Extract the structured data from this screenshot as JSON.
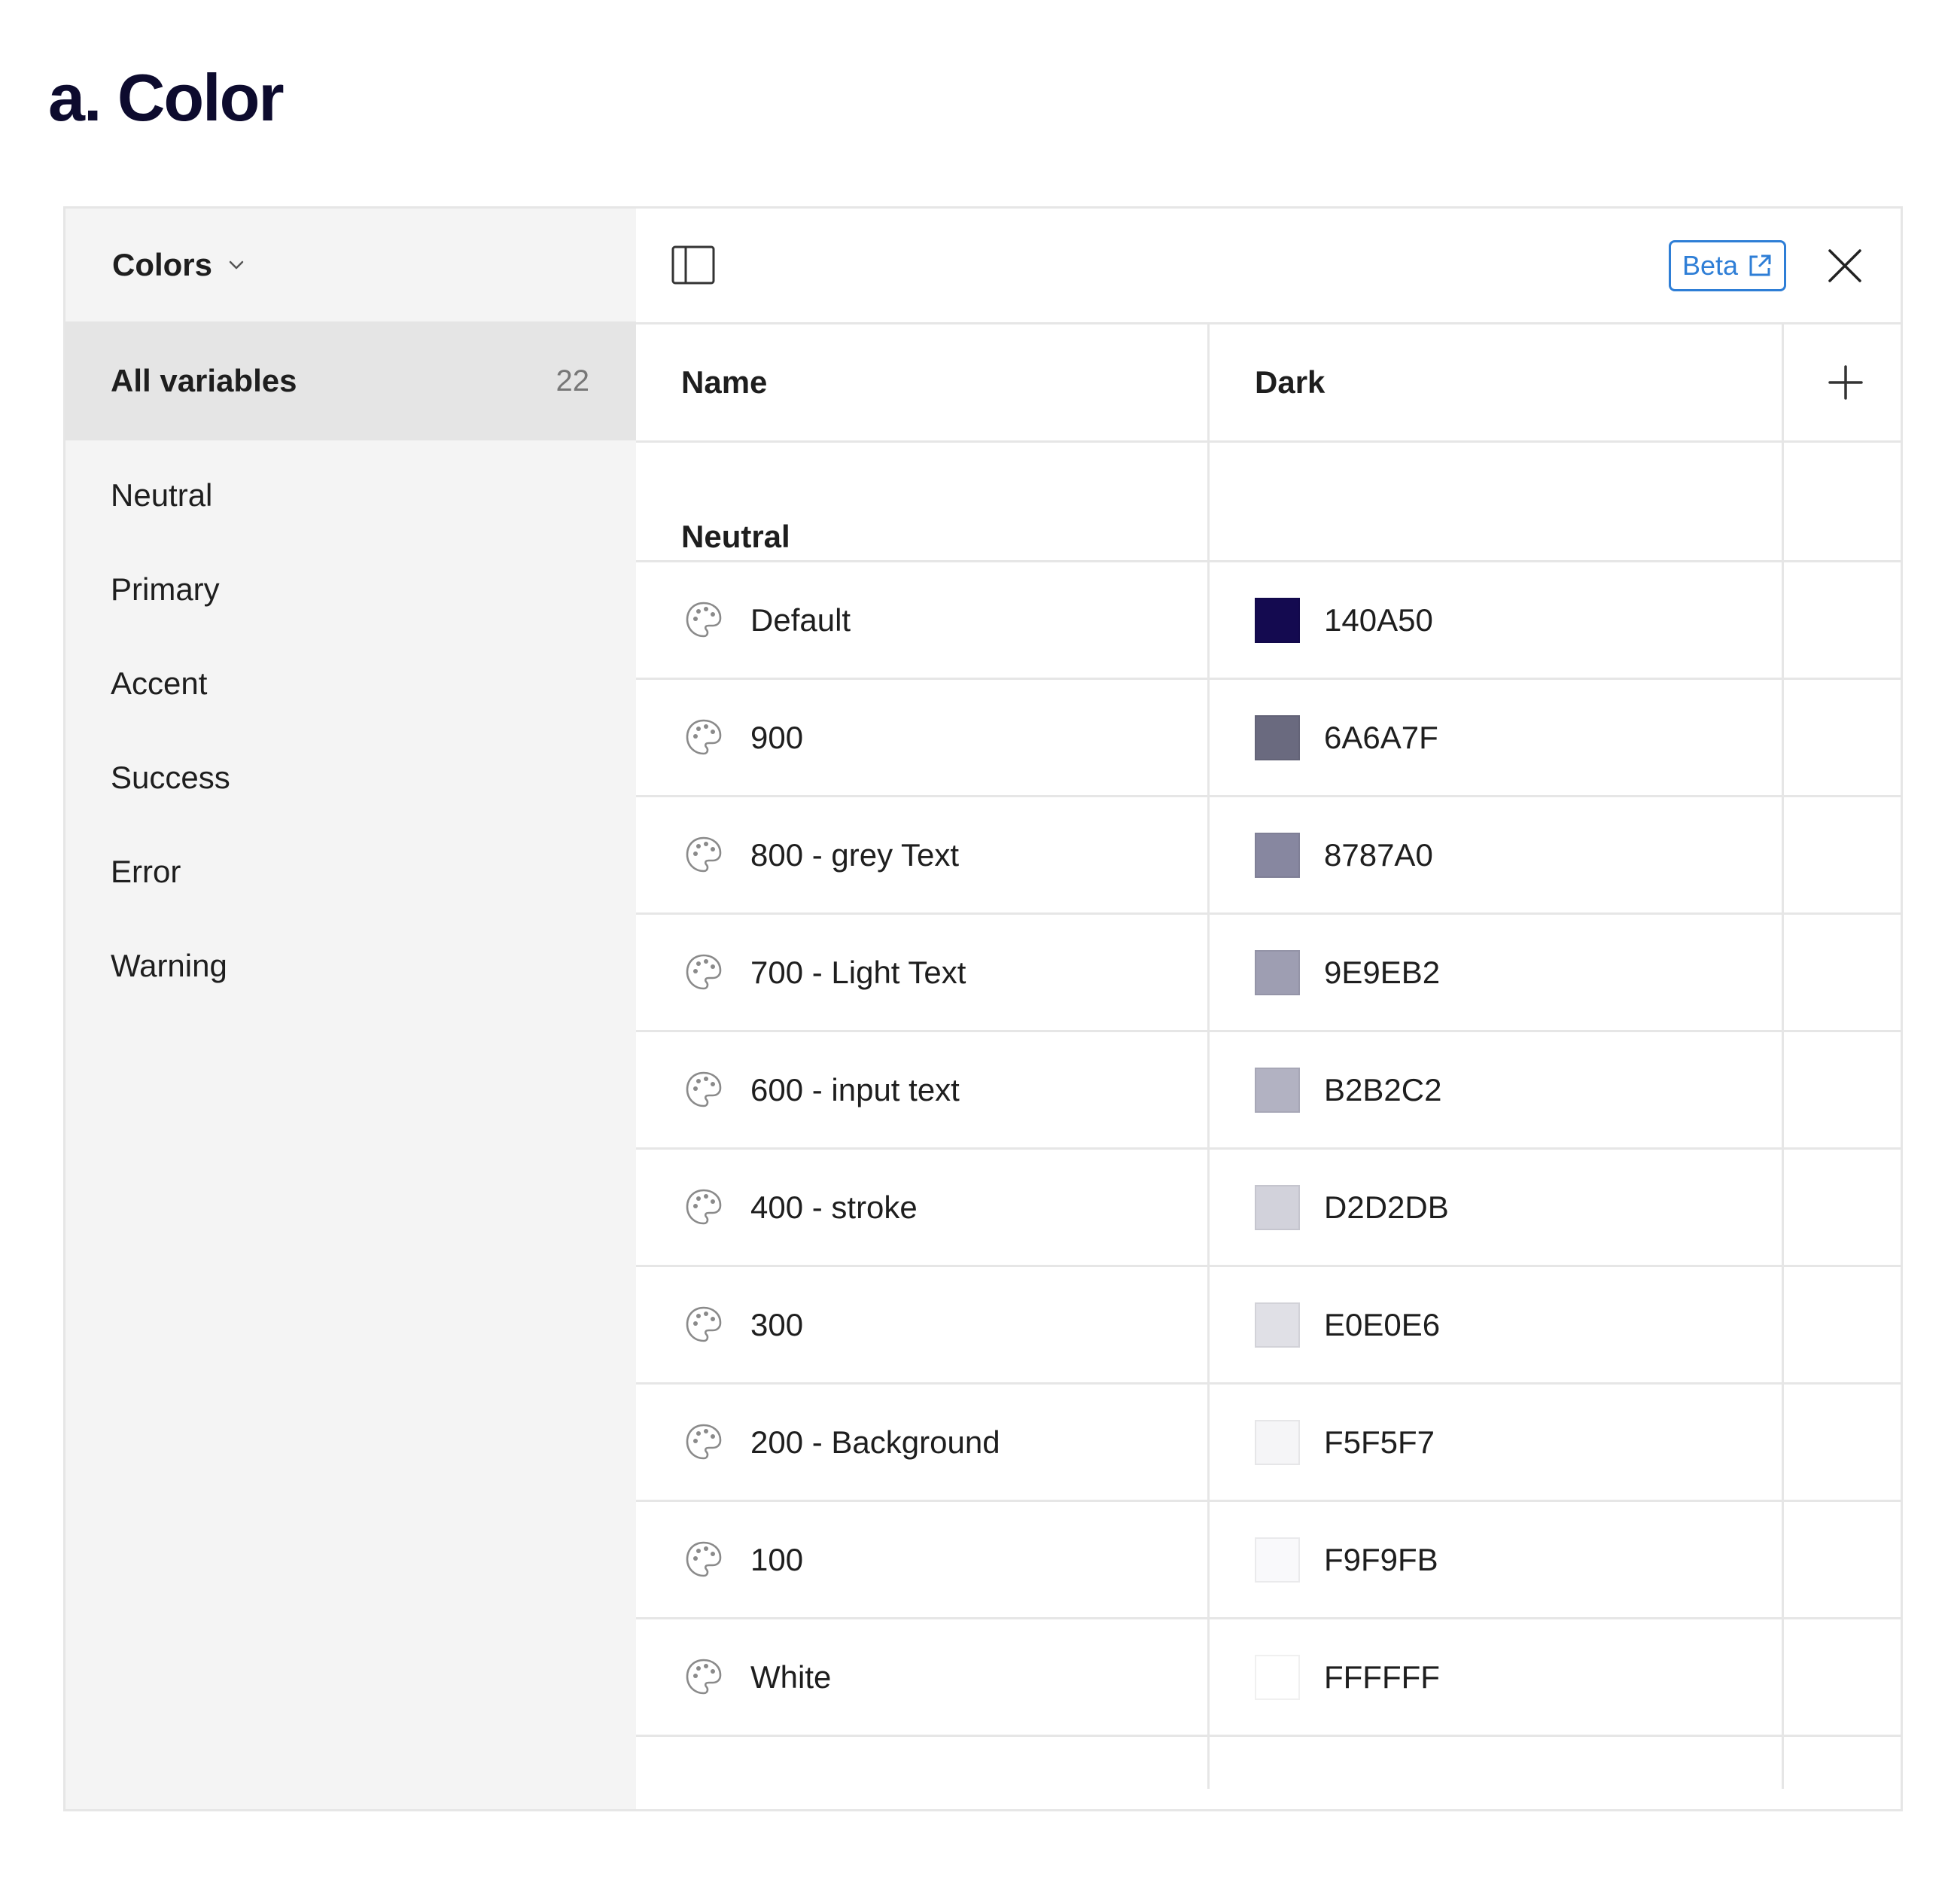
{
  "heading": "a. Color",
  "sidebar": {
    "collection": "Colors",
    "all_variables": {
      "label": "All variables",
      "count": "22"
    },
    "groups": [
      "Neutral",
      "Primary",
      "Accent",
      "Success",
      "Error",
      "Warning"
    ]
  },
  "toolbar": {
    "beta_label": "Beta"
  },
  "table": {
    "headers": {
      "name": "Name",
      "mode": "Dark"
    },
    "group_title": "Neutral",
    "rows": [
      {
        "name": "Default",
        "value": "140A50",
        "color": "#140A50"
      },
      {
        "name": "900",
        "value": "6A6A7F",
        "color": "#6A6A7F"
      },
      {
        "name": "800 - grey Text",
        "value": "8787A0",
        "color": "#8787A0"
      },
      {
        "name": "700 - Light Text",
        "value": "9E9EB2",
        "color": "#9E9EB2"
      },
      {
        "name": "600 - input text",
        "value": "B2B2C2",
        "color": "#B2B2C2"
      },
      {
        "name": "400 - stroke",
        "value": "D2D2DB",
        "color": "#D2D2DB"
      },
      {
        "name": "300",
        "value": "E0E0E6",
        "color": "#E0E0E6"
      },
      {
        "name": "200 - Background",
        "value": "F5F5F7",
        "color": "#F5F5F7"
      },
      {
        "name": "100",
        "value": "F9F9FB",
        "color": "#F9F9FB"
      },
      {
        "name": "White",
        "value": "FFFFFF",
        "color": "#FFFFFF"
      }
    ]
  },
  "colors": {
    "accent": "#2E7ED6",
    "heading": "#0D0B2E",
    "sidebar_bg": "#F4F4F4",
    "selected_bg": "#E5E5E5"
  }
}
